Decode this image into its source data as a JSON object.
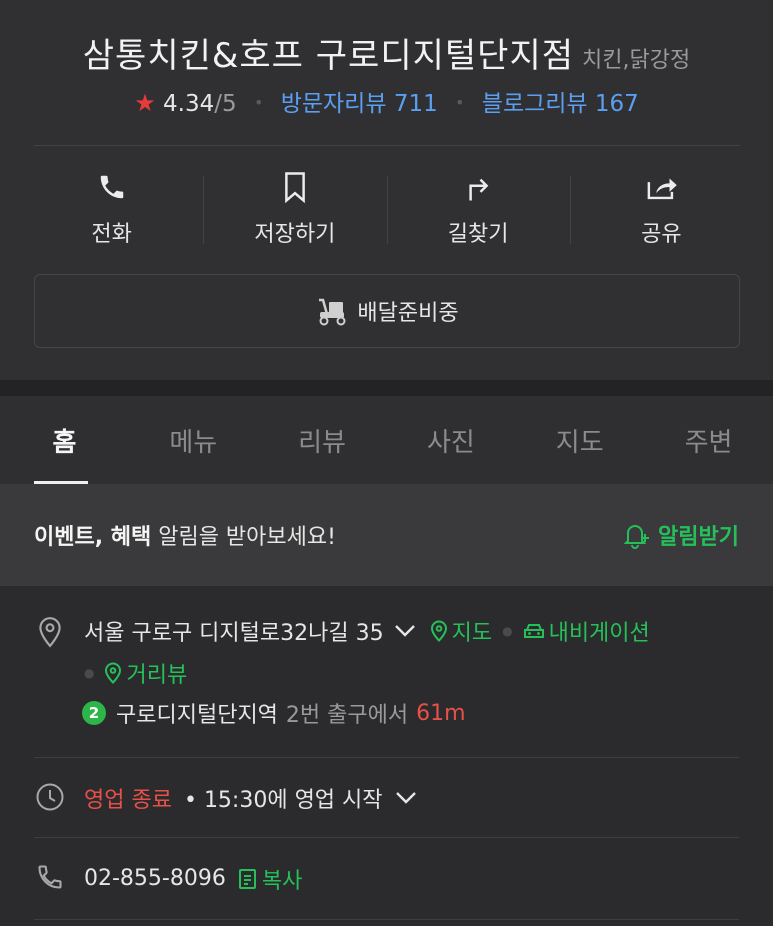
{
  "header": {
    "title": "삼통치킨&호프 구로디지털단지점",
    "category": "치킨,닭강정",
    "rating": "4.34",
    "rating_max": "/5",
    "visitor_reviews": "방문자리뷰 711",
    "blog_reviews": "블로그리뷰 167"
  },
  "actions": [
    {
      "label": "전화",
      "icon": "phone-icon"
    },
    {
      "label": "저장하기",
      "icon": "bookmark-icon"
    },
    {
      "label": "길찾기",
      "icon": "directions-icon"
    },
    {
      "label": "공유",
      "icon": "share-icon"
    }
  ],
  "delivery": {
    "label": "배달준비중",
    "icon": "delivery-scooter-icon"
  },
  "tabs": [
    {
      "label": "홈",
      "active": true
    },
    {
      "label": "메뉴"
    },
    {
      "label": "리뷰"
    },
    {
      "label": "사진"
    },
    {
      "label": "지도"
    },
    {
      "label": "주변"
    }
  ],
  "banner": {
    "bold_text": "이벤트, 혜택",
    "text": " 알림을 받아보세요!",
    "button_label": "알림받기"
  },
  "address": {
    "street": "서울 구로구 디지털로32나길 35",
    "map_link": "지도",
    "navigation_link": "내비게이션",
    "street_view_link": "거리뷰",
    "subway_line": "2",
    "station": "구로디지털단지역",
    "exit": "2번 출구에서",
    "distance": "61m"
  },
  "hours": {
    "status": "영업 종료",
    "next_open": "• 15:30에 영업 시작"
  },
  "phone": {
    "number": "02-855-8096",
    "copy_label": "복사"
  },
  "colors": {
    "accent_green": "#25c05a",
    "link_blue": "#5b9ff2",
    "alert_red": "#e8504a",
    "star_red": "#e83a3a",
    "background": "#2b2b2d"
  }
}
